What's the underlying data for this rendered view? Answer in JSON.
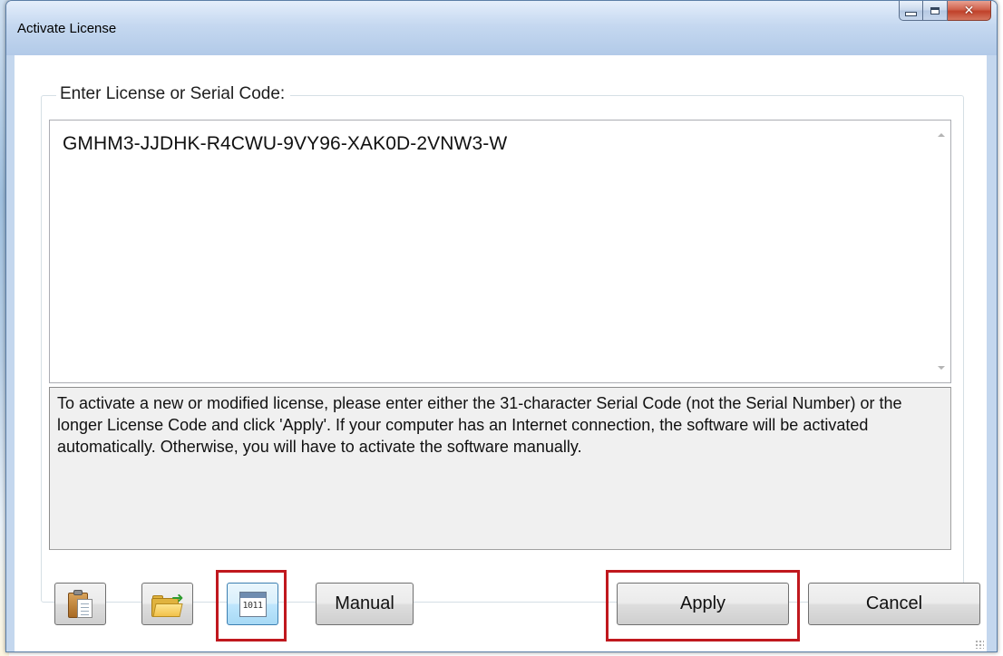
{
  "window": {
    "title": "Activate License",
    "caption_buttons": {
      "minimize": "minimize-icon",
      "maximize": "maximize-icon",
      "close": "close-icon"
    }
  },
  "license": {
    "group_label": "Enter License or Serial Code:",
    "code_value": "GMHM3-JJDHK-R4CWU-9VY96-XAK0D-2VNW3-W"
  },
  "info": {
    "text": "To activate a new or modified license, please enter either the 31-character Serial Code (not the Serial Number) or the longer License Code and click 'Apply'.  If your computer has an Internet connection, the software will be activated automatically.  Otherwise, you will have to activate the software manually."
  },
  "buttons": {
    "paste_icon": "clipboard-paste-icon",
    "open_icon": "open-folder-icon",
    "binary_icon": "binary-1011-icon",
    "binary_icon_text": "1011",
    "manual_label": "Manual",
    "apply_label": "Apply",
    "cancel_label": "Cancel"
  },
  "colors": {
    "highlight": "#c0181e",
    "titlebar": "#c5d8f0",
    "close_button": "#c0412a"
  }
}
